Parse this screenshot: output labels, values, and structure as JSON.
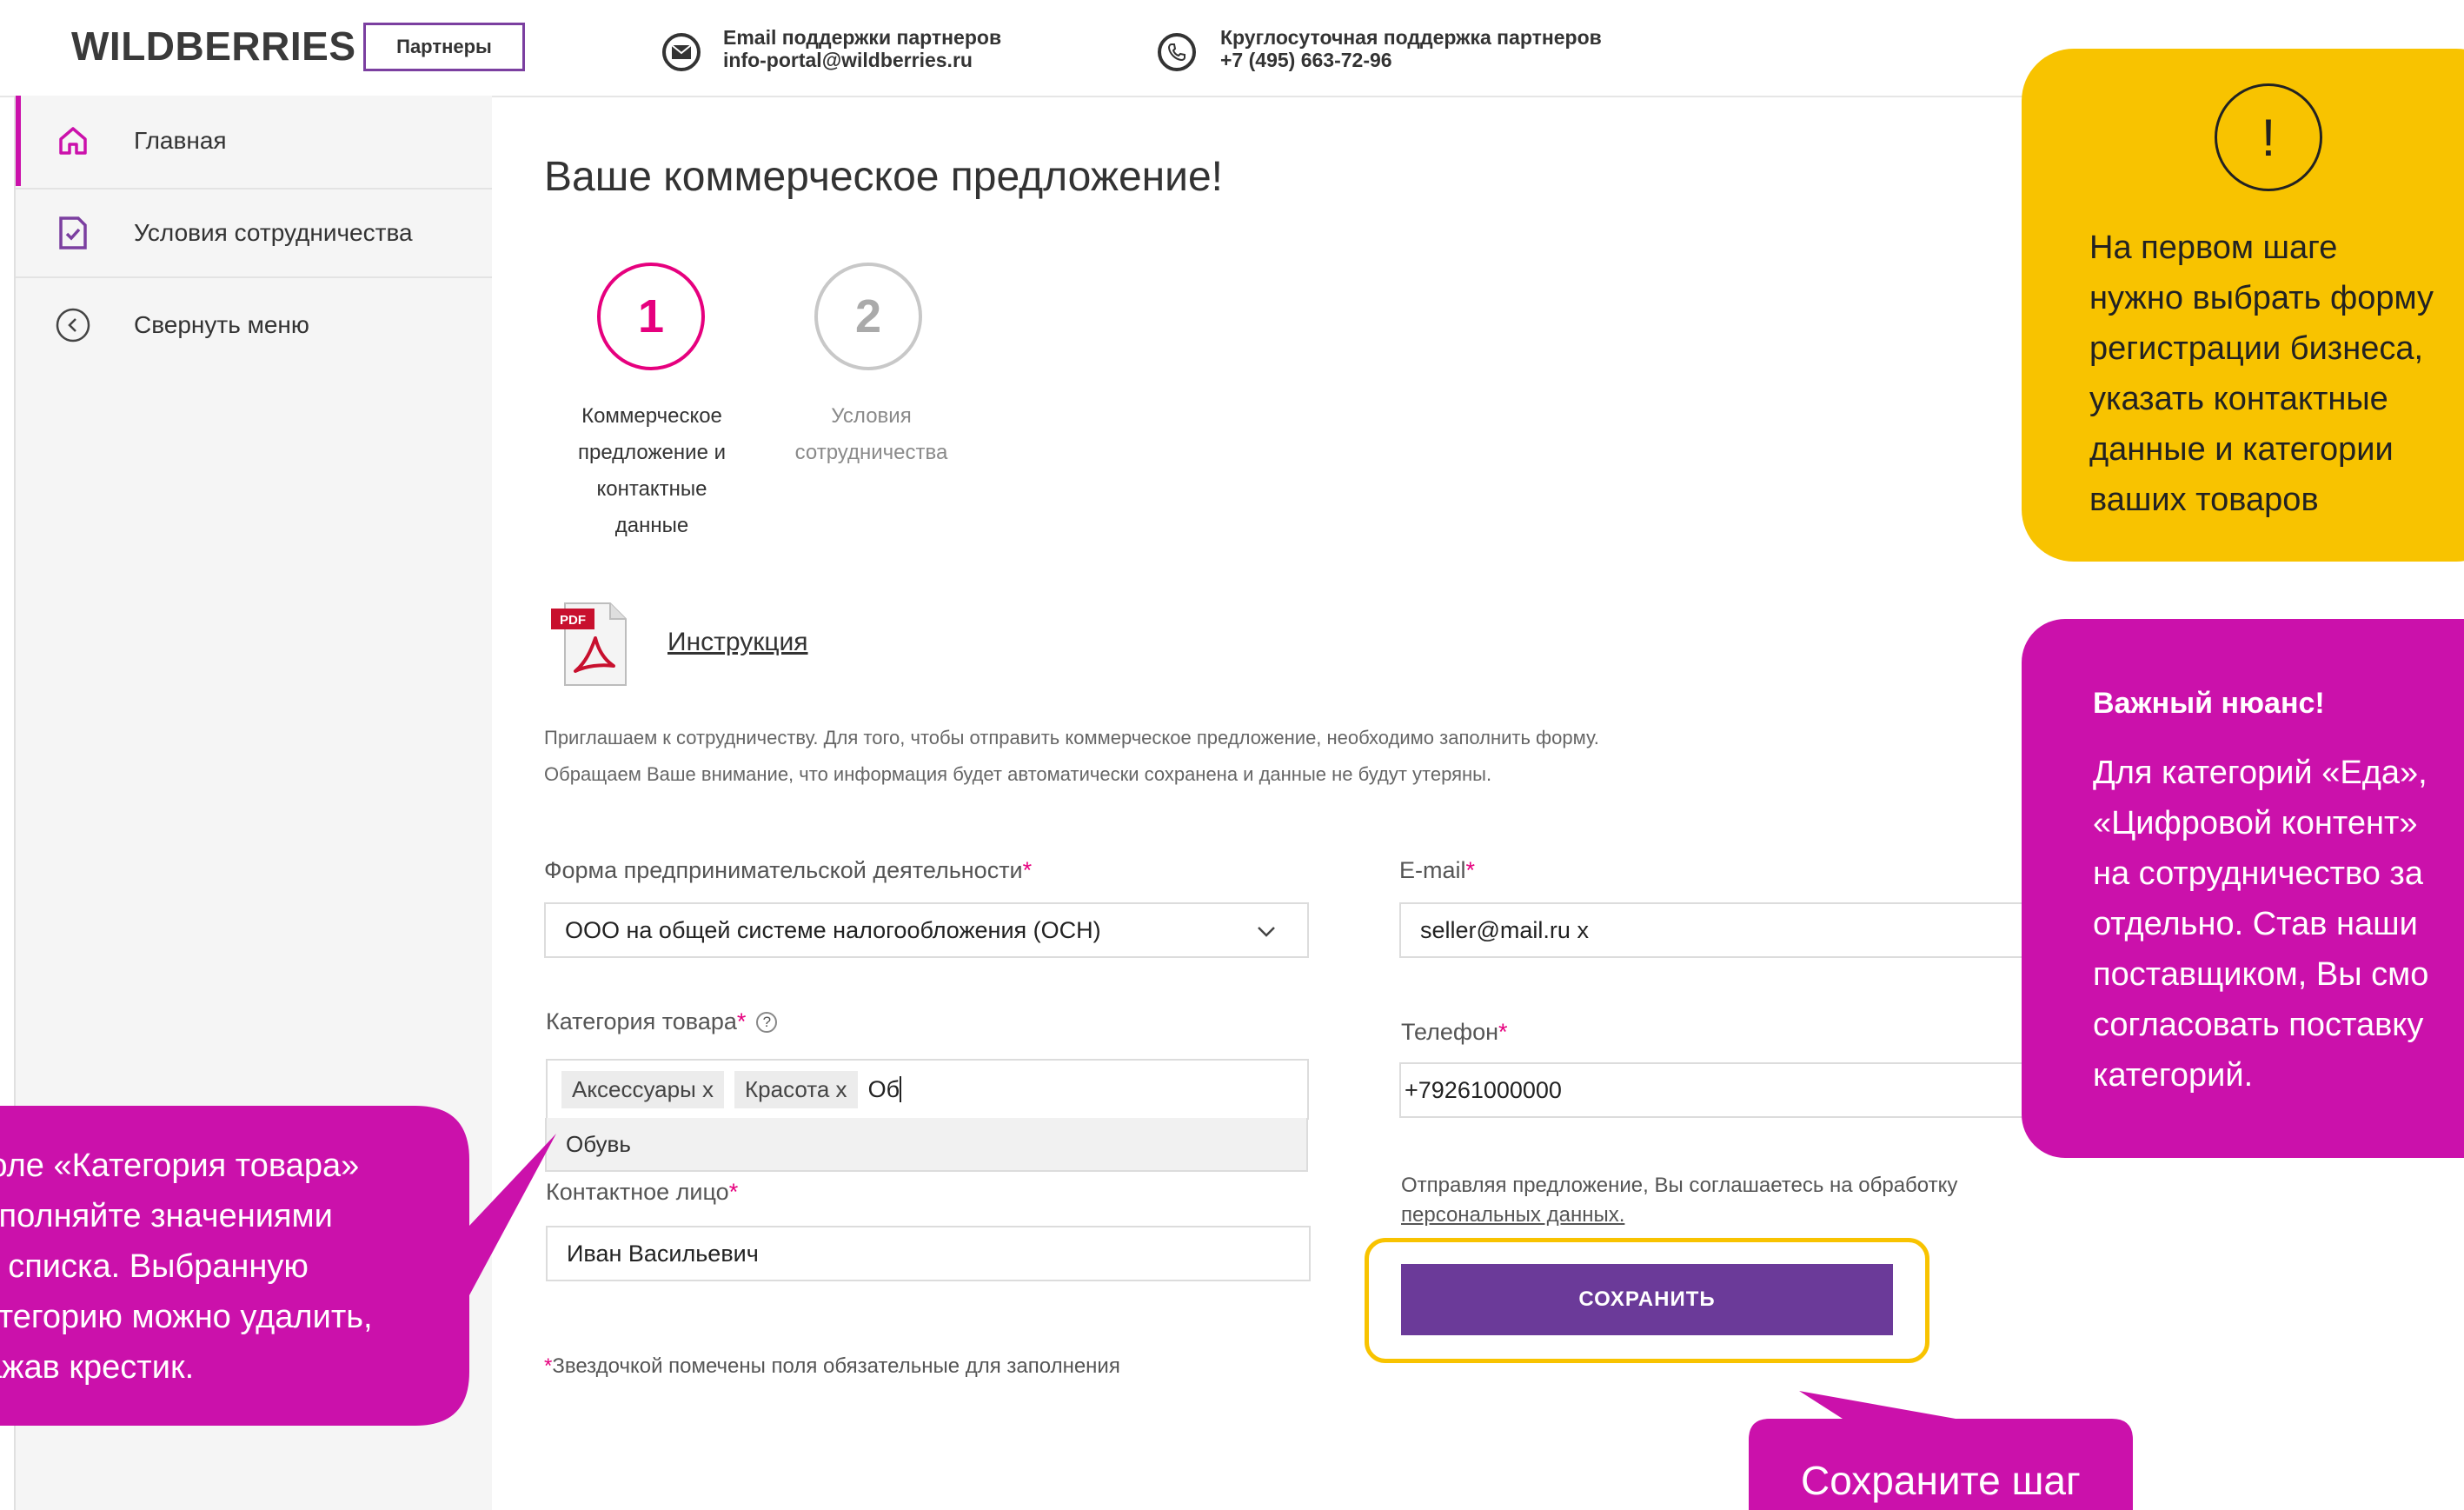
{
  "header": {
    "logo": "WILDBERRIES",
    "badge": "Партнеры",
    "email_title": "Email поддержки партнеров",
    "email_value": "info-portal@wildberries.ru",
    "phone_title": "Круглосуточная поддержка партнеров",
    "phone_value": "+7 (495) 663-72-96"
  },
  "sidebar": {
    "items": [
      {
        "label": "Главная",
        "icon": "home-icon"
      },
      {
        "label": "Условия сотрудничества",
        "icon": "document-check-icon"
      },
      {
        "label": "Свернуть меню",
        "icon": "chevron-left-circle-icon"
      }
    ]
  },
  "main": {
    "title": "Ваше коммерческое предложение!",
    "steps": [
      {
        "number": "1",
        "label_lines": [
          "Коммерческое",
          "предложение и",
          "контактные",
          "данные"
        ]
      },
      {
        "number": "2",
        "label_lines": [
          "Условия",
          "сотрудничества"
        ]
      }
    ],
    "pdf_icon_text": "PDF",
    "instruction_link": "Инструкция",
    "intro_line1": "Приглашаем к сотрудничеству. Для того, чтобы отправить коммерческое предложение, необходимо заполнить форму.",
    "intro_line2": "Обращаем Ваше внимание, что информация будет автоматически сохранена и данные не будут утеряны.",
    "form": {
      "business_form_label": "Форма предпринимательской деятельности",
      "business_form_value": "ООО на общей системе налогообложения (ОСН)",
      "category_label": "Категория товара",
      "category_help": "?",
      "category_tags": [
        "Аксессуары x",
        "Красота x"
      ],
      "category_typed": "Об",
      "category_option": "Обувь",
      "contact_label": "Контактное лицо",
      "contact_value": "Иван Васильевич",
      "email_label": "E-mail",
      "email_value": "seller@mail.ru x",
      "phone_label": "Телефон",
      "phone_value": "+79261000000",
      "consent_text": "Отправляя предложение, Вы соглашаетесь на обработку",
      "consent_link": "персональных данных.",
      "save_button": "СОХРАНИТЬ",
      "required_mark": "*",
      "required_note": "Звездочкой помечены поля обязательные для заполнения"
    }
  },
  "callouts": {
    "tip1_symbol": "!",
    "tip1_lines": [
      "На первом шаге",
      "нужно выбрать форму",
      "регистрации бизнеса,",
      "указать контактные",
      "данные и категории",
      "ваших товаров"
    ],
    "tip2_title": "Важный нюанс!",
    "tip2_lines": [
      "Для категорий «Еда»,",
      "«Цифровой контент»",
      "на сотрудничество за",
      "отдельно. Став наши",
      "поставщиком, Вы смо",
      "согласовать поставку",
      "категорий."
    ],
    "tip3_lines": [
      "Поле «Категория товара»",
      "заполняйте значениями",
      "из списка. Выбранную",
      "категорию можно удалить,",
      "нажав крестик."
    ],
    "tip4_text": "Сохраните шаг"
  },
  "colors": {
    "accent_pink": "#e6007e",
    "callout_pink": "#cb11ab",
    "callout_yellow": "#f8c300",
    "button_purple": "#6b3a99"
  }
}
